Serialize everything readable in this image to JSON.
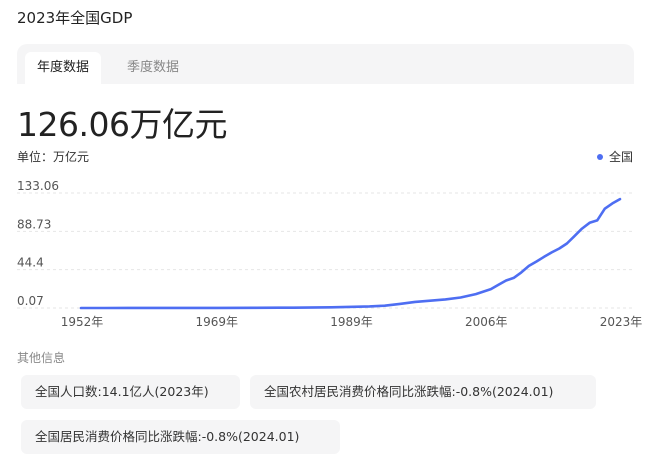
{
  "title": "2023年全国GDP",
  "tabs": [
    {
      "label": "年度数据",
      "active": true
    },
    {
      "label": "季度数据",
      "active": false
    }
  ],
  "headline_value": "126.06万亿元",
  "unit_label": "单位：万亿元",
  "legend_label": "全国",
  "accent_color": "#4e6ef2",
  "chart_data": {
    "type": "line",
    "series": [
      {
        "name": "全国",
        "x": [
          1952,
          1955,
          1960,
          1965,
          1970,
          1975,
          1978,
          1980,
          1985,
          1990,
          1992,
          1994,
          1996,
          1998,
          2000,
          2002,
          2004,
          2006,
          2007,
          2008,
          2009,
          2010,
          2011,
          2012,
          2013,
          2014,
          2015,
          2016,
          2017,
          2018,
          2019,
          2020,
          2021,
          2022,
          2023
        ],
        "values": [
          0.07,
          0.09,
          0.15,
          0.17,
          0.23,
          0.3,
          0.37,
          0.46,
          0.91,
          1.89,
          2.72,
          4.86,
          7.18,
          8.52,
          10.03,
          12.17,
          16.18,
          21.94,
          27.0,
          31.92,
          34.85,
          41.21,
          48.79,
          53.86,
          59.3,
          64.36,
          68.89,
          74.64,
          83.2,
          91.93,
          98.65,
          101.36,
          114.92,
          121.02,
          126.06
        ]
      }
    ],
    "xticks": [
      "1952年",
      "1969年",
      "1989年",
      "2006年",
      "2023年"
    ],
    "yticks": [
      "133.06",
      "88.73",
      "44.4",
      "0.07"
    ],
    "xlim": [
      1952,
      2023
    ],
    "ylim": [
      0.07,
      133.06
    ],
    "grid": "horizontal-dashed",
    "legend_position": "top-right"
  },
  "other_info": {
    "title": "其他信息",
    "items": [
      "全国人口数:14.1亿人(2023年)",
      "全国农村居民消费价格同比涨跌幅:-0.8%(2024.01)",
      "全国居民消费价格同比涨跌幅:-0.8%(2024.01)"
    ]
  }
}
